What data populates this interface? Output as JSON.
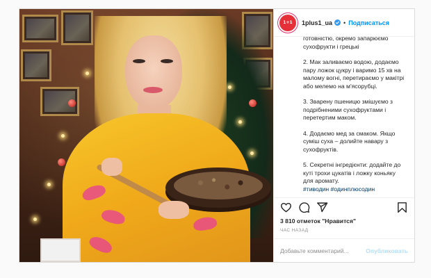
{
  "header": {
    "username": "1plus1_ua",
    "follow_label": "Подписаться",
    "separator": "•",
    "avatar_text": "1+1",
    "avatar_color": "#e5303a",
    "verified_color": "#3897f0"
  },
  "photo": {
    "alt": "Woman in yellow dress holding a bowl of kutia in front of a Christmas tree"
  },
  "caption": {
    "paragraphs": [
      "готовністю, окремо запарюємо сухофрукти і грецькі",
      "2. Мак заливаємо водою, додаємо пару ложок цукру і варимо 15 хв на малому вогні, перетираємо у макітрі або мелемо на м'ясорубці.",
      "3. Зварену пшеницю змішуємо з подрібненими сухофруктами і перетертим маком.",
      "4. Додаємо мед за смаком. Якщо суміш суха – долийте навару з сухофруктів.",
      "5. Секретні інгредієнти: додайте до куті трохи цукатів і ложку коньяку для аромату."
    ],
    "hashtags": "#тиводин #одинплюсодин"
  },
  "actions": {
    "like_icon": "heart-icon",
    "comment_icon": "comment-icon",
    "share_icon": "share-icon",
    "save_icon": "bookmark-icon"
  },
  "likes_text": "3 810 отметок \"Нравится\"",
  "timestamp": "ЧАС НАЗАД",
  "comment": {
    "placeholder": "Добавьте комментарий...",
    "publish_label": "Опубликовать"
  },
  "colors": {
    "link_blue": "#0095f6",
    "hashtag": "#00376b",
    "publish_disabled": "#b2dffc",
    "dress_yellow": "#f7c62b"
  }
}
